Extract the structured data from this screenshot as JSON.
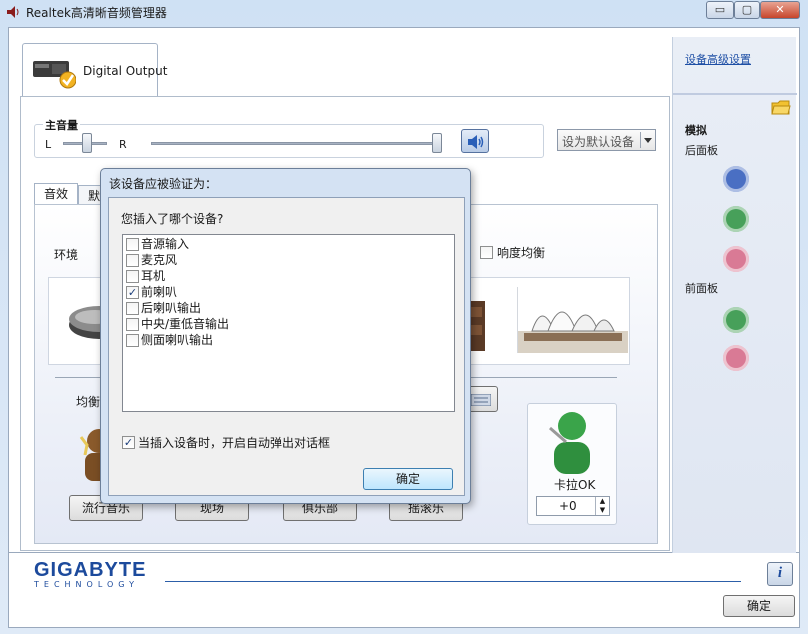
{
  "window": {
    "title": "Realtek高清晰音频管理器",
    "min": "▭",
    "max": "▢",
    "close": "✕"
  },
  "device_tab": {
    "label": "Digital Output"
  },
  "right_panel": {
    "advanced_link": "设备高级设置",
    "analog_label": "模拟",
    "back_panel_label": "后面板",
    "front_panel_label": "前面板",
    "jack_colors": {
      "blue": "#4a6fc3",
      "green": "#47a05a",
      "pink": "#d97a95"
    }
  },
  "volume": {
    "label": "主音量",
    "left": "L",
    "right": "R",
    "balance": 0.5,
    "level": 1.0
  },
  "default_device": {
    "label": "设为默认设备"
  },
  "sub_tabs": [
    {
      "label": "音效"
    },
    {
      "label": "默认"
    }
  ],
  "effects": {
    "environment_label": "环境",
    "loudness_label": "响度均衡",
    "equalizer_label": "均衡器",
    "presets": [
      "流行音乐",
      "现场",
      "俱乐部",
      "摇滚乐"
    ],
    "karaoke_label": "卡拉OK",
    "karaoke_value": "+0"
  },
  "dialog": {
    "title": "该设备应被验证为：",
    "question": "您插入了哪个设备?",
    "options": [
      {
        "label": "音源输入",
        "checked": false
      },
      {
        "label": "麦克风",
        "checked": false
      },
      {
        "label": "耳机",
        "checked": false
      },
      {
        "label": "前喇叭",
        "checked": true
      },
      {
        "label": "后喇叭输出",
        "checked": false
      },
      {
        "label": "中央/重低音输出",
        "checked": false
      },
      {
        "label": "侧面喇叭输出",
        "checked": false
      }
    ],
    "auto_popup_label": "当插入设备时，开启自动弹出对话框",
    "auto_popup_checked": true,
    "ok_label": "确定"
  },
  "footer": {
    "brand": "GIGABYTE",
    "brand_sub": "TECHNOLOGY",
    "ok_label": "确定",
    "info_icon": "i"
  }
}
